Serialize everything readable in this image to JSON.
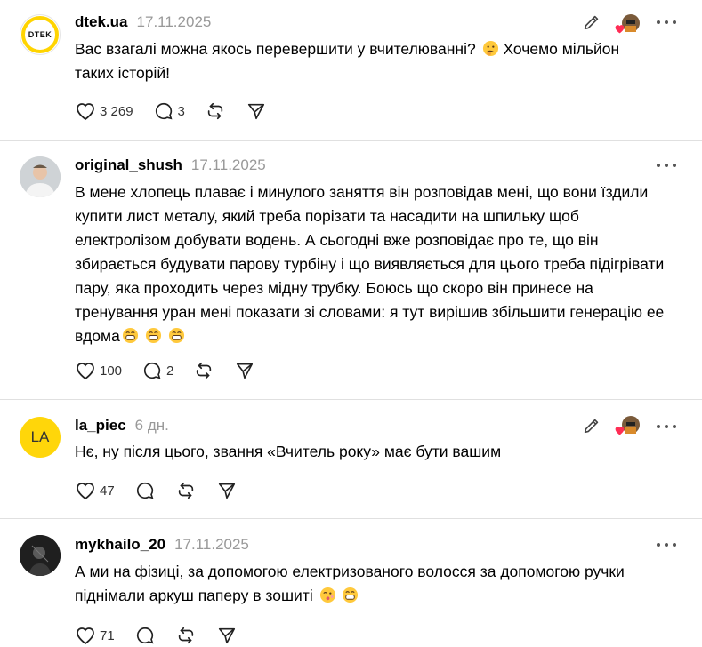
{
  "posts": [
    {
      "username": "dtek.ua",
      "avatar_text": "DTEK",
      "date": "17.11.2025",
      "text": "Вас взагалі можна якось перевершити у вчителюванні?",
      "text_tail": " Хочемо мільйон\nтаких історій!",
      "likes": "3 269",
      "replies": "3",
      "author_liked": true
    },
    {
      "username": "original_shush",
      "date": "17.11.2025",
      "text": "В мене хлопець плаває і минулого заняття він розповідав мені, що вони їздили купити лист металу, який треба порізати та насадити на шпильку щоб електролізом добувати водень. А сьогодні вже розповідає про те, що він збирається будувати парову турбіну і що виявляється для цього треба підігрівати пару, яка проходить через мідну трубку. Боюсь що скоро він принесе на тренування уран мені показати зі словами: я тут вирішив збільшити генерацію ее вдома",
      "likes": "100",
      "replies": "2"
    },
    {
      "username": "la_piec",
      "avatar_text": "LA",
      "date": "6 дн.",
      "text": "Нє, ну після цього, звання «Вчитель року» має бути вашим",
      "likes": "47",
      "author_liked": true
    },
    {
      "username": "mykhailo_20",
      "date": "17.11.2025",
      "text": "А ми на фізиці, за допомогою електризованого волосся за допомогою ручки піднімали аркуш паперу в зошиті",
      "likes": "71"
    }
  ],
  "icons": {
    "like": "heart-icon",
    "reply": "comment-icon",
    "repost": "repost-icon",
    "share": "send-icon",
    "more": "more-icon",
    "edit": "pencil-icon"
  },
  "colors": {
    "accent_yellow": "#ffd60a",
    "heart_red": "#ff2d55",
    "muted": "#999999",
    "divider": "#e0e0e0"
  }
}
